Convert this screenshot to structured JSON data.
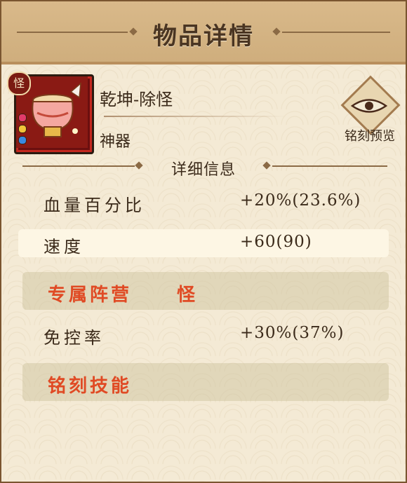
{
  "header": {
    "title": "物品详情"
  },
  "item": {
    "name": "乾坤-除怪",
    "type": "神器",
    "badge": "怪",
    "engrave_preview_label": "铭刻预览"
  },
  "details": {
    "title": "详细信息",
    "stats": [
      {
        "label": "血量百分比",
        "value": "+20%(23.6%)"
      },
      {
        "label": "速度",
        "value": "+60(90)"
      }
    ],
    "faction": {
      "label": "专属阵营",
      "value": "怪"
    },
    "control": {
      "label": "免控率",
      "value": "+30%(37%)"
    },
    "engrave_skill": {
      "label": "铭刻技能"
    }
  },
  "colors": {
    "accent_red": "#e04a24",
    "header_bg": "#d2b17f",
    "panel_bg": "#f4ead5"
  }
}
